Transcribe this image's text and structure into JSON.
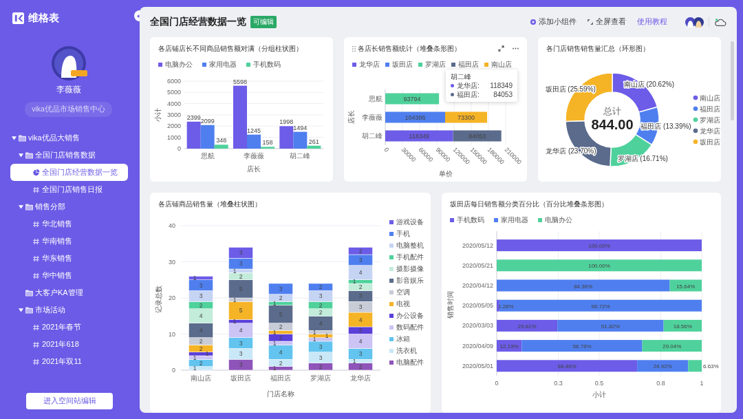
{
  "sidebar": {
    "logo": "维格表",
    "user": {
      "name": "李薇薇",
      "team": "vika优品市场销售中心"
    },
    "tree": [
      {
        "kind": "folder",
        "label": "vika优品大销售",
        "expanded": true,
        "selected": false,
        "children": [
          {
            "kind": "folder",
            "label": "全国门店销售数据",
            "expanded": true,
            "selected": false,
            "children": [
              {
                "kind": "dashboard",
                "label": "全国门店经营数据一览",
                "selected": true
              },
              {
                "kind": "sheet",
                "label": "全国门店销售日报",
                "selected": false
              }
            ]
          },
          {
            "kind": "folder",
            "label": "销售分部",
            "expanded": true,
            "selected": false,
            "children": [
              {
                "kind": "sheet",
                "label": "华北销售",
                "selected": false
              },
              {
                "kind": "sheet",
                "label": "华南销售",
                "selected": false
              },
              {
                "kind": "sheet",
                "label": "华东销售",
                "selected": false
              },
              {
                "kind": "sheet",
                "label": "华中销售",
                "selected": false
              }
            ]
          },
          {
            "kind": "folder",
            "label": "大客户KA管理",
            "selected": false
          },
          {
            "kind": "folder",
            "label": "市场活动",
            "expanded": true,
            "selected": false,
            "children": [
              {
                "kind": "sheet",
                "label": "2021年春节",
                "selected": false
              },
              {
                "kind": "sheet",
                "label": "2021年618",
                "selected": false
              },
              {
                "kind": "sheet",
                "label": "2021年双11",
                "selected": false
              }
            ]
          }
        ]
      }
    ],
    "edit_button": "进入空间站编辑"
  },
  "header": {
    "title": "全国门店经营数据一览",
    "badge": "可编辑",
    "actions": [
      {
        "kind": "add",
        "label": "添加小组件"
      },
      {
        "kind": "fullscreen",
        "label": "全屏查看"
      },
      {
        "kind": "link",
        "label": "使用教程"
      }
    ]
  },
  "widgets": [
    {
      "chart_data": {
        "type": "bar",
        "title": "各店铺店长不同商品销售额对满（分组柱状图）",
        "xlabel": "店长",
        "ylabel": "小计",
        "categories": [
          "思航",
          "李薇薇",
          "胡二峰"
        ],
        "series": [
          {
            "name": "电脑办公",
            "color": "#6c5ce7",
            "values": [
              2399,
              5598,
              1998
            ]
          },
          {
            "name": "家用电器",
            "color": "#4f7fef",
            "values": [
              2099,
              1245,
              1494
            ]
          },
          {
            "name": "手机数码",
            "color": "#4fd19c",
            "values": [
              348,
              158,
              261
            ]
          }
        ],
        "ylim": [
          0,
          6000
        ],
        "yticks": [
          0,
          1000,
          2000,
          3000,
          4000,
          5000,
          6000
        ],
        "grid": true,
        "data_labels": true
      }
    },
    {
      "focused": true,
      "chart_data": {
        "type": "bar",
        "orientation": "horizontal",
        "stacked": true,
        "title": "各店长销售额统计（堆叠条形图）",
        "xlabel": "单价",
        "ylabel": "店长",
        "categories": [
          "思航",
          "李薇薇",
          "胡二峰"
        ],
        "series": [
          {
            "name": "龙华店",
            "color": "#6c5ce7",
            "values": [
              null,
              null,
              118349
            ]
          },
          {
            "name": "坂田店",
            "color": "#4f7fef",
            "values": [
              null,
              104386,
              null
            ]
          },
          {
            "name": "罗湖店",
            "color": "#4fd19c",
            "values": [
              93794,
              null,
              null
            ]
          },
          {
            "name": "福田店",
            "color": "#5a6b8c",
            "values": [
              null,
              null,
              84053
            ]
          },
          {
            "name": "南山店",
            "color": "#f5b326",
            "values": [
              null,
              73300,
              null
            ]
          }
        ],
        "xlim": [
          0,
          210000
        ],
        "xticks": [
          0,
          30000,
          60000,
          90000,
          120000,
          150000,
          180000,
          210000
        ],
        "grid": true,
        "data_labels": true
      },
      "tooltip": {
        "title": "胡二峰",
        "rows": [
          {
            "label": "龙华店:",
            "value": "118349",
            "color": "#6c5ce7"
          },
          {
            "label": "福田店:",
            "value": "84053",
            "color": "#5a6b8c"
          }
        ]
      }
    },
    {
      "chart_data": {
        "type": "donut",
        "title": "各门店销售销售量汇总（环形图）",
        "values": [
          20.62,
          13.39,
          16.71,
          23.7,
          25.59
        ],
        "value_labels": [
          "南山店 (20.62%)",
          "福田店 (13.39%)",
          "罗湖店 (16.71%)",
          "龙华店 (23.70%)",
          "坂田店 (25.59%)"
        ]
      },
      "legend": [
        {
          "label": "南山店",
          "color": "#6c5ce7"
        },
        {
          "label": "福田店",
          "color": "#4f7fef"
        },
        {
          "label": "罗湖店",
          "color": "#4fd19c"
        },
        {
          "label": "龙华店",
          "color": "#5a6b8c"
        },
        {
          "label": "坂田店",
          "color": "#f5b326"
        }
      ],
      "total": {
        "label": "总计",
        "value": "844.00"
      }
    },
    {
      "chart_data": {
        "type": "bar",
        "stacked": true,
        "title": "各店铺商品销售量（堆叠柱状图）",
        "xlabel": "门店名称",
        "ylabel": "记录总数",
        "categories": [
          "南山店",
          "坂田店",
          "福田店",
          "罗湖店",
          "龙华店"
        ],
        "series": [
          {
            "name": "游戏设备",
            "color": "#6c5ce7",
            "values": [
              1,
              3,
              null,
              null,
              2
            ]
          },
          {
            "name": "手机",
            "color": "#4f7fef",
            "values": [
              3,
              3,
              3,
              2,
              3
            ]
          },
          {
            "name": "电脑整机",
            "color": "#c6d4f4",
            "values": [
              3,
              1,
              2,
              3,
              4
            ]
          },
          {
            "name": "手机配件",
            "color": "#4fd19c",
            "values": [
              2,
              null,
              1,
              2,
              1
            ]
          },
          {
            "name": "摄影摄像",
            "color": "#c3ecda",
            "values": [
              4,
              2,
              null,
              2,
              2
            ]
          },
          {
            "name": "影音娱乐",
            "color": "#5a6b8c",
            "values": [
              4,
              5,
              5,
              4,
              3
            ]
          },
          {
            "name": "空调",
            "color": "#c8ccd6",
            "values": [
              2,
              1,
              2,
              1,
              3
            ]
          },
          {
            "name": "电视",
            "color": "#f5b326",
            "values": [
              2,
              5,
              1,
              1,
              4
            ]
          },
          {
            "name": "办公设备",
            "color": "#5b3fd9",
            "values": [
              1,
              1,
              2,
              null,
              2
            ]
          },
          {
            "name": "数码配件",
            "color": "#cbc4f5",
            "values": [
              1,
              4,
              1,
              1,
              4
            ]
          },
          {
            "name": "冰箱",
            "color": "#62c4ef",
            "values": [
              2,
              3,
              4,
              3,
              3
            ]
          },
          {
            "name": "洗衣机",
            "color": "#c9e8f7",
            "values": [
              1,
              3,
              2,
              3,
              1
            ]
          },
          {
            "name": "电脑配件",
            "color": "#8e54b9",
            "values": [
              null,
              3,
              1,
              2,
              2
            ]
          }
        ],
        "ylim": [
          0,
          40
        ],
        "yticks": [
          0,
          10,
          20,
          30,
          40
        ],
        "grid": true,
        "data_labels": true
      }
    },
    {
      "chart_data": {
        "type": "bar",
        "orientation": "horizontal",
        "stacked": true,
        "title": "坂田店每日销售额分类百分比（百分比堆叠条形图）",
        "xlabel": "小计",
        "ylabel": "销售时间",
        "categories": [
          "2020/05/12",
          "2020/05/21",
          "2020/04/12",
          "2020/05/05",
          "2020/03/03",
          "2020/04/09",
          "2020/05/01"
        ],
        "series": [
          {
            "name": "手机数码",
            "color": "#6c5ce7",
            "values": [
              1,
              null,
              null,
              0.013,
              0.296,
              0.122,
              0.685
            ]
          },
          {
            "name": "家用电器",
            "color": "#4f7fef",
            "values": [
              null,
              null,
              0.844,
              0.987,
              0.518,
              0.588,
              0.249
            ]
          },
          {
            "name": "电脑办公",
            "color": "#4fd19c",
            "values": [
              null,
              1,
              0.156,
              null,
              0.186,
              0.29,
              0.066
            ]
          }
        ],
        "value_labels": [
          [
            "100.00%",
            null,
            null,
            "1.28%",
            "29.61%",
            "12.19%",
            "68.46%"
          ],
          [
            null,
            null,
            "84.36%",
            "98.72%",
            "51.82%",
            "58.78%",
            "24.92%"
          ],
          [
            null,
            "100.00%",
            "15.64%",
            null,
            "18.56%",
            "29.04%",
            "6.63%"
          ]
        ],
        "xlim": [
          0,
          1
        ],
        "xticks": [
          0,
          0.3,
          0.5,
          0.8,
          1
        ],
        "grid": true
      }
    }
  ]
}
